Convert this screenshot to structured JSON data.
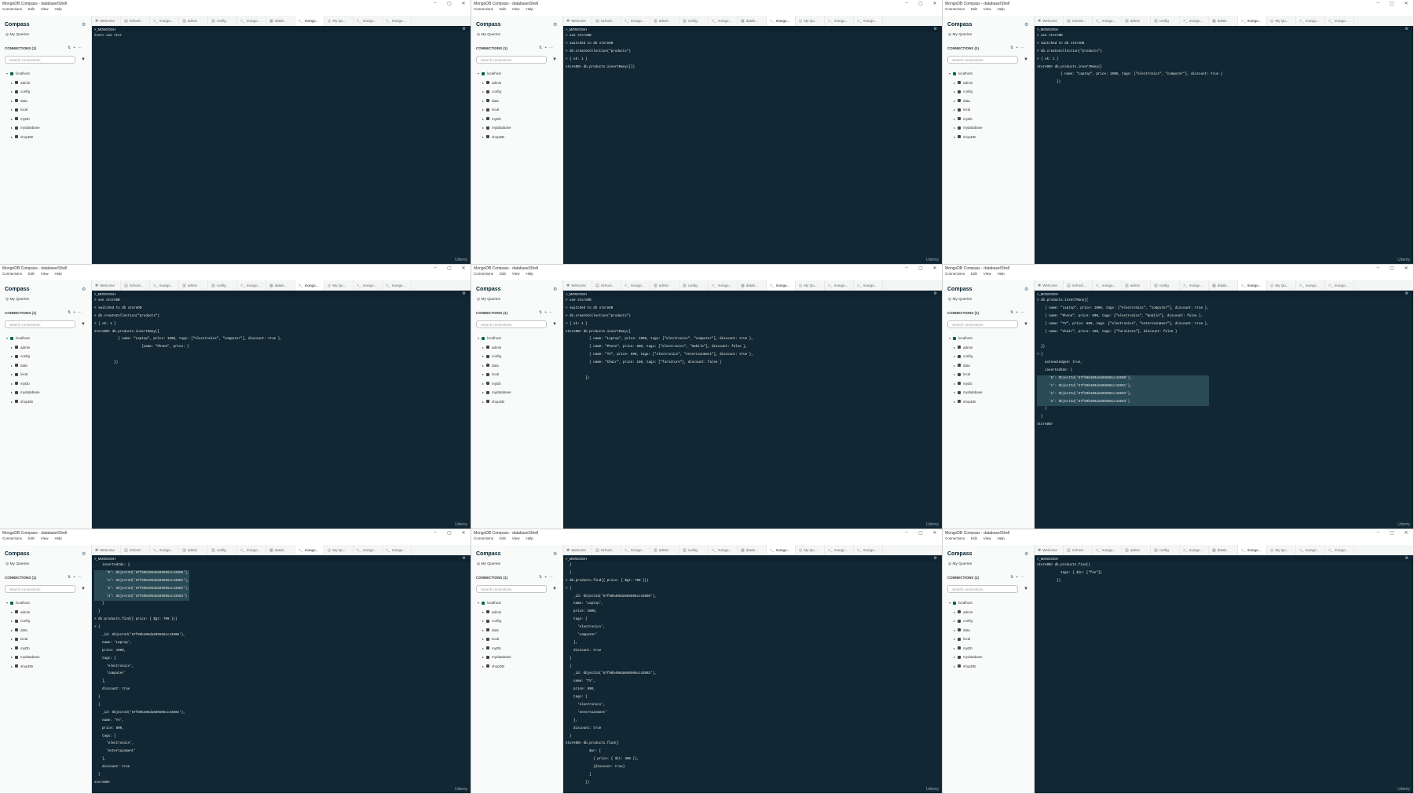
{
  "app": {
    "window_title": "MongoDB Compass - database/Shell",
    "brand": "Compass",
    "my_queries": "My Queries",
    "connections_header": "CONNECTIONS (1)",
    "search_placeholder": "Search connections",
    "shell_header": ">_MONGOSH",
    "watermark": "Udemy",
    "window_controls": [
      "–",
      "▢",
      "✕"
    ],
    "menu": [
      "Connections",
      "Edit",
      "View",
      "Help"
    ],
    "tabs": [
      {
        "icon": "welcome-icon",
        "glyph": "✱",
        "label": "Welcome"
      },
      {
        "icon": "folder-icon",
        "glyph": "▤",
        "label": "School..."
      },
      {
        "icon": "shell-icon",
        "glyph": ">_",
        "label": "mongo..."
      },
      {
        "icon": "database-icon",
        "glyph": "▥",
        "label": "admin"
      },
      {
        "icon": "database-icon",
        "glyph": "▥",
        "label": "config"
      },
      {
        "icon": "shell-icon",
        "glyph": ">_",
        "label": "mongo..."
      },
      {
        "icon": "collection-icon",
        "glyph": "▦",
        "label": "datab..."
      },
      {
        "icon": "shell-icon",
        "glyph": ">_",
        "label": "mongo...",
        "active": true
      },
      {
        "icon": "queries-icon",
        "glyph": "◎",
        "label": "My Qu..."
      },
      {
        "icon": "shell-icon",
        "glyph": ">_",
        "label": "mongo..."
      },
      {
        "icon": "shell-icon",
        "glyph": ">_",
        "label": "mongo..."
      }
    ],
    "tree": {
      "root": "localhost",
      "databases": [
        "admin",
        "config",
        "data",
        "local",
        "myDb",
        "mydatabase",
        "shopDB"
      ]
    },
    "colors": {
      "shell_bg": "#112733",
      "accent_green": "#00ed64",
      "sidebar_bg": "#f9fbfa"
    }
  },
  "panes": [
    {
      "lines": [
        "test> use stor"
      ]
    },
    {
      "lines": [
        "> use storeDB",
        "< switched to db storeDB",
        "> db.createCollection(\"products\")",
        "< { ok: 1 }",
        "storeDB> db.products.insertMany([])"
      ]
    },
    {
      "lines": [
        "> use storeDB",
        "< switched to db storeDB",
        "> db.createCollection(\"products\")",
        "< { ok: 1 }",
        "storeDB> db.products.insertMany([",
        "            { name: \"Laptop\", price: 1000, tags: [\"electronics\", \"computer\"], discount: true }",
        "          ])"
      ]
    },
    {
      "lines": [
        "> use storeDB",
        "< switched to db storeDB",
        "> db.createCollection(\"products\")",
        "< { ok: 1 }",
        "storeDB> db.products.insertMany([",
        "            { name: \"Laptop\", price: 1000, tags: [\"electronics\", \"computer\"], discount: true },",
        "                        {name: \"Phone\", price: }",
        "",
        "          ])"
      ]
    },
    {
      "lines": [
        "> use storeDB",
        "< switched to db storeDB",
        "> db.createCollection(\"products\")",
        "< { ok: 1 }",
        "storeDB> db.products.insertMany([",
        "            { name: \"Laptop\", price: 1000, tags: [\"electronics\", \"computer\"], discount: true },",
        "            { name: \"Phone\", price: 600, tags: [\"electronics\", \"mobile\"], discount: false },",
        "            { name: \"TV\", price: 800, tags: [\"electronics\", \"entertainment\"], discount: true },",
        "            { name: \"Chair\", price: 150, tags: [\"furniture\"], discount: false }",
        "",
        "          ])"
      ]
    },
    {
      "lines": [
        "> db.products.insertMany([",
        "    { name: \"Laptop\", price: 1000, tags: [\"electronics\", \"computer\"], discount: true },",
        "    { name: \"Phone\", price: 600, tags: [\"electronics\", \"mobile\"], discount: false },",
        "    { name: \"TV\", price: 800, tags: [\"electronics\", \"entertainment\"], discount: true },",
        "    { name: \"Chair\", price: 150, tags: [\"furniture\"], discount: false }",
        "",
        "  ])",
        "< {",
        "    acknowledged: true,",
        "    insertedIds: {",
        "      '0': ObjectId('67f80b406da695505cc43500'),",
        "      '1': ObjectId('67f80b406da695505cc43501'),",
        "      '2': ObjectId('67f80b406da695505cc43502'),",
        "      '3': ObjectId('67f80b406da695505cc43503')",
        "    }",
        "  }",
        "storeDB>"
      ],
      "highlight": [
        10,
        11,
        12,
        13
      ]
    },
    {
      "lines": [
        "    insertedIds: {",
        "      '0': ObjectId('67f80b406da695505cc43500'),",
        "      '1': ObjectId('67f80b406da695505cc43501'),",
        "      '2': ObjectId('67f80b406da695505cc43502'),",
        "      '3': ObjectId('67f80b406da695505cc43503')",
        "    }",
        "  }",
        "> db.products.find({ price: { $gt: 700 }})",
        "< {",
        "    _id: ObjectId('67f80b406da695505cc43500'),",
        "    name: 'Laptop',",
        "    price: 1000,",
        "    tags: [",
        "      'electronics',",
        "      'computer'",
        "    ],",
        "    discount: true",
        "  }",
        "  {",
        "    _id: ObjectId('67f80b406da695505cc43502'),",
        "    name: 'TV',",
        "    price: 800,",
        "    tags: [",
        "      'electronics',",
        "      'entertainment'",
        "    ],",
        "    discount: true",
        "  }",
        "storeDB>"
      ],
      "highlight": [
        1,
        2,
        3,
        4
      ]
    },
    {
      "lines": [
        "  }",
        "  }",
        "> db.products.find({ price: { $gt: 700 }})",
        "< {",
        "    _id: ObjectId('67f80b406da695505cc43500'),",
        "    name: 'Laptop',",
        "    price: 1000,",
        "    tags: [",
        "      'electronics',",
        "      'computer'",
        "    ],",
        "    discount: true",
        "  }",
        "  {",
        "    _id: ObjectId('67f80b406da695505cc43502'),",
        "    name: 'TV',",
        "    price: 800,",
        "    tags: [",
        "      'electronics',",
        "      'entertainment'",
        "    ],",
        "    discount: true",
        "  }",
        "storeDB> db.products.find({",
        "            $or: [",
        "              { price: { $lt: 300 }},",
        "              {discount: true}",
        "            ]",
        "          })"
      ]
    },
    {
      "lines": [
        "storeDB> db.products.find({",
        "            tags: { $in: [\"fun\"]}",
        "          })"
      ]
    }
  ]
}
